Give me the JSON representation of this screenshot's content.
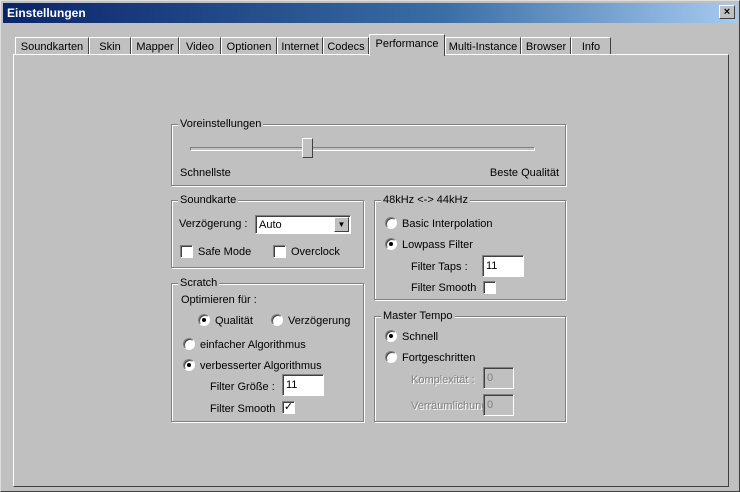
{
  "window": {
    "title": "Einstellungen",
    "close_label": "×"
  },
  "tabs": [
    {
      "label": "Soundkarten"
    },
    {
      "label": "Skin"
    },
    {
      "label": "Mapper"
    },
    {
      "label": "Video"
    },
    {
      "label": "Optionen"
    },
    {
      "label": "Internet"
    },
    {
      "label": "Codecs"
    },
    {
      "label": "Performance"
    },
    {
      "label": "Multi-Instance"
    },
    {
      "label": "Browser"
    },
    {
      "label": "Info"
    }
  ],
  "active_tab": "Performance",
  "presets": {
    "label": "Voreinstellungen",
    "min_label": "Schnellste",
    "max_label": "Beste Qualität",
    "slider_value": 0.34
  },
  "soundcard": {
    "label": "Soundkarte",
    "latency_label": "Verzögerung :",
    "latency_value": "Auto",
    "safe_mode_label": "Safe Mode",
    "safe_mode_checked": false,
    "overclock_label": "Overclock",
    "overclock_checked": false
  },
  "resample": {
    "label": "48kHz <-> 44kHz",
    "basic_label": "Basic Interpolation",
    "lowpass_label": "Lowpass Filter",
    "selected": "lowpass",
    "filter_taps_label": "Filter Taps :",
    "filter_taps_value": "11",
    "filter_smooth_label": "Filter Smooth",
    "filter_smooth_checked": false
  },
  "scratch": {
    "label": "Scratch",
    "optimize_label": "Optimieren für :",
    "quality_label": "Qualität",
    "latency_label": "Verzögerung",
    "optimize_selected": "quality",
    "simple_algo_label": "einfacher Algorithmus",
    "improved_algo_label": "verbesserter Algorithmus",
    "algo_selected": "improved",
    "filter_size_label": "Filter Größe :",
    "filter_size_value": "11",
    "filter_smooth_label": "Filter Smooth",
    "filter_smooth_checked": true,
    "check_mark": "✓"
  },
  "master_tempo": {
    "label": "Master Tempo",
    "fast_label": "Schnell",
    "advanced_label": "Fortgeschritten",
    "selected": "fast",
    "complexity_label": "Komplexität :",
    "complexity_value": "0",
    "spatial_label": "Verräumlichung :",
    "spatial_value": "0"
  }
}
